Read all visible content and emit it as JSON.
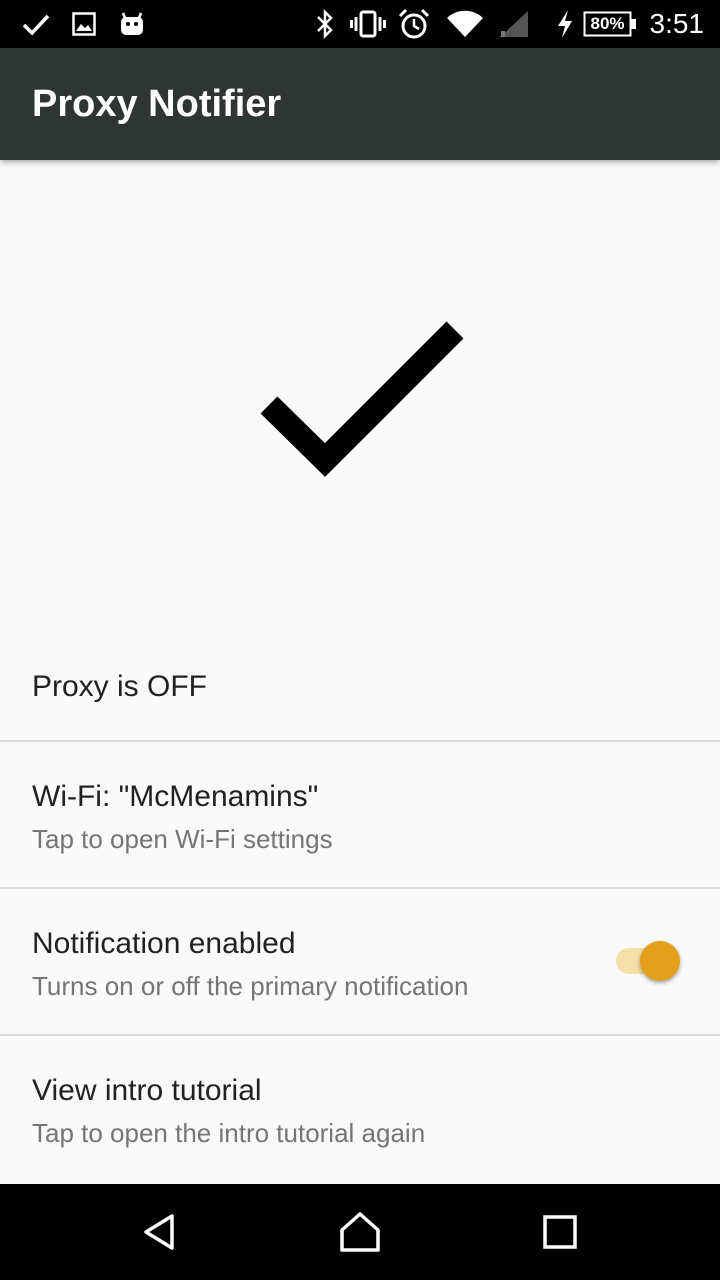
{
  "status_bar": {
    "battery_percent": "80%",
    "time": "3:51",
    "left_icons": [
      "check-icon",
      "image-icon",
      "android-icon"
    ],
    "right_icons": [
      "bluetooth-icon",
      "vibrate-icon",
      "alarm-icon",
      "wifi-icon",
      "cell-signal-icon",
      "charging-icon",
      "battery-icon"
    ]
  },
  "app_bar": {
    "title": "Proxy Notifier",
    "background_color": "#2f3533"
  },
  "main": {
    "status_icon": "checkmark-icon",
    "proxy_status": "Proxy is OFF",
    "preferences": [
      {
        "title": "Wi-Fi: \"McMenamins\"",
        "summary": "Tap to open Wi-Fi settings"
      },
      {
        "title": "Notification enabled",
        "summary": "Turns on or off the primary notification",
        "toggle_on": true
      },
      {
        "title": "View intro tutorial",
        "summary": "Tap to open the intro tutorial again"
      }
    ],
    "accent_color": "#e5a01b"
  },
  "nav_bar": {
    "buttons": [
      "back-icon",
      "home-icon",
      "recents-icon"
    ]
  }
}
